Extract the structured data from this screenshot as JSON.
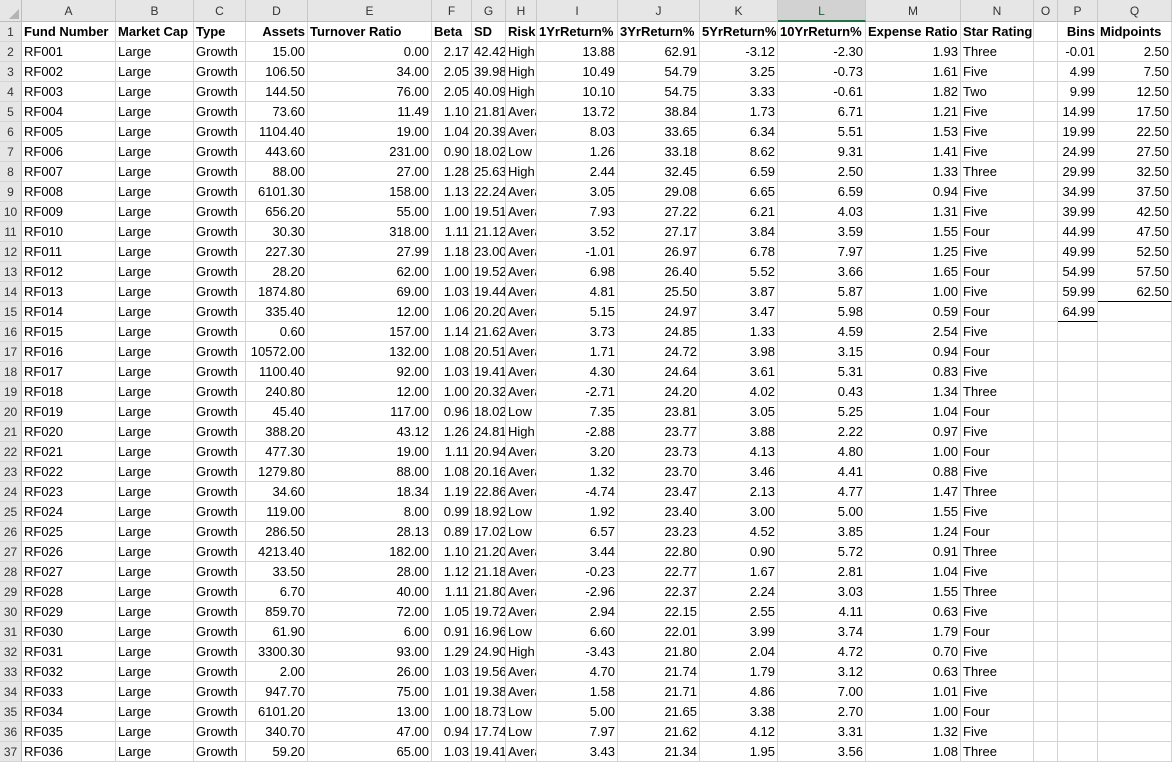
{
  "sheet": {
    "col_letters": [
      "A",
      "B",
      "C",
      "D",
      "E",
      "F",
      "G",
      "H",
      "I",
      "J",
      "K",
      "L",
      "M",
      "N",
      "O",
      "P",
      "Q"
    ],
    "selected_col": "L",
    "headers": [
      "Fund Number",
      "Market Cap",
      "Type",
      "Assets",
      "Turnover Ratio",
      "Beta",
      "SD",
      "Risk",
      "1YrReturn%",
      "3YrReturn%",
      "5YrReturn%",
      "10YrReturn%",
      "Expense Ratio",
      "Star Rating",
      "",
      "Bins",
      "Midpoints"
    ],
    "rows": [
      [
        "RF001",
        "Large",
        "Growth",
        "15.00",
        "0.00",
        "2.17",
        "42.42",
        "High",
        "13.88",
        "62.91",
        "-3.12",
        "-2.30",
        "1.93",
        "Three",
        "",
        "-0.01",
        "2.50"
      ],
      [
        "RF002",
        "Large",
        "Growth",
        "106.50",
        "34.00",
        "2.05",
        "39.98",
        "High",
        "10.49",
        "54.79",
        "3.25",
        "-0.73",
        "1.61",
        "Five",
        "",
        "4.99",
        "7.50"
      ],
      [
        "RF003",
        "Large",
        "Growth",
        "144.50",
        "76.00",
        "2.05",
        "40.09",
        "High",
        "10.10",
        "54.75",
        "3.33",
        "-0.61",
        "1.82",
        "Two",
        "",
        "9.99",
        "12.50"
      ],
      [
        "RF004",
        "Large",
        "Growth",
        "73.60",
        "11.49",
        "1.10",
        "21.81",
        "Average",
        "13.72",
        "38.84",
        "1.73",
        "6.71",
        "1.21",
        "Five",
        "",
        "14.99",
        "17.50"
      ],
      [
        "RF005",
        "Large",
        "Growth",
        "1104.40",
        "19.00",
        "1.04",
        "20.39",
        "Average",
        "8.03",
        "33.65",
        "6.34",
        "5.51",
        "1.53",
        "Five",
        "",
        "19.99",
        "22.50"
      ],
      [
        "RF006",
        "Large",
        "Growth",
        "443.60",
        "231.00",
        "0.90",
        "18.02",
        "Low",
        "1.26",
        "33.18",
        "8.62",
        "9.31",
        "1.41",
        "Five",
        "",
        "24.99",
        "27.50"
      ],
      [
        "RF007",
        "Large",
        "Growth",
        "88.00",
        "27.00",
        "1.28",
        "25.63",
        "High",
        "2.44",
        "32.45",
        "6.59",
        "2.50",
        "1.33",
        "Three",
        "",
        "29.99",
        "32.50"
      ],
      [
        "RF008",
        "Large",
        "Growth",
        "6101.30",
        "158.00",
        "1.13",
        "22.24",
        "Average",
        "3.05",
        "29.08",
        "6.65",
        "6.59",
        "0.94",
        "Five",
        "",
        "34.99",
        "37.50"
      ],
      [
        "RF009",
        "Large",
        "Growth",
        "656.20",
        "55.00",
        "1.00",
        "19.51",
        "Average",
        "7.93",
        "27.22",
        "6.21",
        "4.03",
        "1.31",
        "Five",
        "",
        "39.99",
        "42.50"
      ],
      [
        "RF010",
        "Large",
        "Growth",
        "30.30",
        "318.00",
        "1.11",
        "21.12",
        "Average",
        "3.52",
        "27.17",
        "3.84",
        "3.59",
        "1.55",
        "Four",
        "",
        "44.99",
        "47.50"
      ],
      [
        "RF011",
        "Large",
        "Growth",
        "227.30",
        "27.99",
        "1.18",
        "23.00",
        "Average",
        "-1.01",
        "26.97",
        "6.78",
        "7.97",
        "1.25",
        "Five",
        "",
        "49.99",
        "52.50"
      ],
      [
        "RF012",
        "Large",
        "Growth",
        "28.20",
        "62.00",
        "1.00",
        "19.52",
        "Average",
        "6.98",
        "26.40",
        "5.52",
        "3.66",
        "1.65",
        "Four",
        "",
        "54.99",
        "57.50"
      ],
      [
        "RF013",
        "Large",
        "Growth",
        "1874.80",
        "69.00",
        "1.03",
        "19.44",
        "Average",
        "4.81",
        "25.50",
        "3.87",
        "5.87",
        "1.00",
        "Five",
        "",
        "59.99",
        "62.50"
      ],
      [
        "RF014",
        "Large",
        "Growth",
        "335.40",
        "12.00",
        "1.06",
        "20.20",
        "Average",
        "5.15",
        "24.97",
        "3.47",
        "5.98",
        "0.59",
        "Four",
        "",
        "64.99",
        ""
      ],
      [
        "RF015",
        "Large",
        "Growth",
        "0.60",
        "157.00",
        "1.14",
        "21.62",
        "Average",
        "3.73",
        "24.85",
        "1.33",
        "4.59",
        "2.54",
        "Five",
        "",
        "",
        ""
      ],
      [
        "RF016",
        "Large",
        "Growth",
        "10572.00",
        "132.00",
        "1.08",
        "20.51",
        "Average",
        "1.71",
        "24.72",
        "3.98",
        "3.15",
        "0.94",
        "Four",
        "",
        "",
        ""
      ],
      [
        "RF017",
        "Large",
        "Growth",
        "1100.40",
        "92.00",
        "1.03",
        "19.41",
        "Average",
        "4.30",
        "24.64",
        "3.61",
        "5.31",
        "0.83",
        "Five",
        "",
        "",
        ""
      ],
      [
        "RF018",
        "Large",
        "Growth",
        "240.80",
        "12.00",
        "1.00",
        "20.32",
        "Average",
        "-2.71",
        "24.20",
        "4.02",
        "0.43",
        "1.34",
        "Three",
        "",
        "",
        ""
      ],
      [
        "RF019",
        "Large",
        "Growth",
        "45.40",
        "117.00",
        "0.96",
        "18.02",
        "Low",
        "7.35",
        "23.81",
        "3.05",
        "5.25",
        "1.04",
        "Four",
        "",
        "",
        ""
      ],
      [
        "RF020",
        "Large",
        "Growth",
        "388.20",
        "43.12",
        "1.26",
        "24.81",
        "High",
        "-2.88",
        "23.77",
        "3.88",
        "2.22",
        "0.97",
        "Five",
        "",
        "",
        ""
      ],
      [
        "RF021",
        "Large",
        "Growth",
        "477.30",
        "19.00",
        "1.11",
        "20.94",
        "Average",
        "3.20",
        "23.73",
        "4.13",
        "4.80",
        "1.00",
        "Four",
        "",
        "",
        ""
      ],
      [
        "RF022",
        "Large",
        "Growth",
        "1279.80",
        "88.00",
        "1.08",
        "20.16",
        "Average",
        "1.32",
        "23.70",
        "3.46",
        "4.41",
        "0.88",
        "Five",
        "",
        "",
        ""
      ],
      [
        "RF023",
        "Large",
        "Growth",
        "34.60",
        "18.34",
        "1.19",
        "22.86",
        "Average",
        "-4.74",
        "23.47",
        "2.13",
        "4.77",
        "1.47",
        "Three",
        "",
        "",
        ""
      ],
      [
        "RF024",
        "Large",
        "Growth",
        "119.00",
        "8.00",
        "0.99",
        "18.92",
        "Low",
        "1.92",
        "23.40",
        "3.00",
        "5.00",
        "1.55",
        "Five",
        "",
        "",
        ""
      ],
      [
        "RF025",
        "Large",
        "Growth",
        "286.50",
        "28.13",
        "0.89",
        "17.02",
        "Low",
        "6.57",
        "23.23",
        "4.52",
        "3.85",
        "1.24",
        "Four",
        "",
        "",
        ""
      ],
      [
        "RF026",
        "Large",
        "Growth",
        "4213.40",
        "182.00",
        "1.10",
        "21.20",
        "Average",
        "3.44",
        "22.80",
        "0.90",
        "5.72",
        "0.91",
        "Three",
        "",
        "",
        ""
      ],
      [
        "RF027",
        "Large",
        "Growth",
        "33.50",
        "28.00",
        "1.12",
        "21.18",
        "Average",
        "-0.23",
        "22.77",
        "1.67",
        "2.81",
        "1.04",
        "Five",
        "",
        "",
        ""
      ],
      [
        "RF028",
        "Large",
        "Growth",
        "6.70",
        "40.00",
        "1.11",
        "21.80",
        "Average",
        "-2.96",
        "22.37",
        "2.24",
        "3.03",
        "1.55",
        "Three",
        "",
        "",
        ""
      ],
      [
        "RF029",
        "Large",
        "Growth",
        "859.70",
        "72.00",
        "1.05",
        "19.72",
        "Average",
        "2.94",
        "22.15",
        "2.55",
        "4.11",
        "0.63",
        "Five",
        "",
        "",
        ""
      ],
      [
        "RF030",
        "Large",
        "Growth",
        "61.90",
        "6.00",
        "0.91",
        "16.96",
        "Low",
        "6.60",
        "22.01",
        "3.99",
        "3.74",
        "1.79",
        "Four",
        "",
        "",
        ""
      ],
      [
        "RF031",
        "Large",
        "Growth",
        "3300.30",
        "93.00",
        "1.29",
        "24.90",
        "High",
        "-3.43",
        "21.80",
        "2.04",
        "4.72",
        "0.70",
        "Five",
        "",
        "",
        ""
      ],
      [
        "RF032",
        "Large",
        "Growth",
        "2.00",
        "26.00",
        "1.03",
        "19.56",
        "Average",
        "4.70",
        "21.74",
        "1.79",
        "3.12",
        "0.63",
        "Three",
        "",
        "",
        ""
      ],
      [
        "RF033",
        "Large",
        "Growth",
        "947.70",
        "75.00",
        "1.01",
        "19.38",
        "Average",
        "1.58",
        "21.71",
        "4.86",
        "7.00",
        "1.01",
        "Five",
        "",
        "",
        ""
      ],
      [
        "RF034",
        "Large",
        "Growth",
        "6101.20",
        "13.00",
        "1.00",
        "18.73",
        "Low",
        "5.00",
        "21.65",
        "3.38",
        "2.70",
        "1.00",
        "Four",
        "",
        "",
        ""
      ],
      [
        "RF035",
        "Large",
        "Growth",
        "340.70",
        "47.00",
        "0.94",
        "17.74",
        "Low",
        "7.97",
        "21.62",
        "4.12",
        "3.31",
        "1.32",
        "Five",
        "",
        "",
        ""
      ],
      [
        "RF036",
        "Large",
        "Growth",
        "59.20",
        "65.00",
        "1.03",
        "19.41",
        "Average",
        "3.43",
        "21.34",
        "1.95",
        "3.56",
        "1.08",
        "Three",
        "",
        "",
        ""
      ]
    ]
  }
}
